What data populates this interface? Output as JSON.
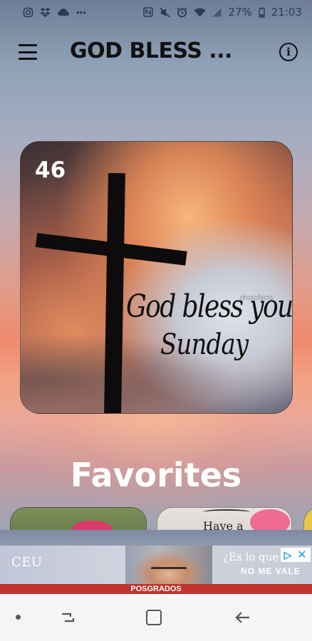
{
  "status_bar": {
    "left_icons": [
      "instagram-icon",
      "dropbox-icon",
      "cloud-icon",
      "more-dots-icon"
    ],
    "right_icons": [
      "nfc-icon",
      "mute-icon",
      "alarm-icon",
      "wifi-icon",
      "signal-icon",
      "battery-icon"
    ],
    "battery": "27%",
    "time": "21:03"
  },
  "app_bar": {
    "title": "GOD BLESS ...",
    "menu_icon": "hamburger-menu-icon",
    "info_icon": "info-icon",
    "info_glyph": "i"
  },
  "main_card": {
    "count": "46",
    "script_line_1": "God bless you",
    "script_line_2": "Sunday",
    "watermark": "photofacts"
  },
  "favorites": {
    "title": "Favorites",
    "item_2_word": "Have a"
  },
  "ad": {
    "brand": "CEU",
    "question": "¿Es lo que",
    "answer": "NO ME VALE",
    "footer": "POSGRADOS",
    "info_glyph": "▷",
    "close_glyph": "✕"
  },
  "nav_bar": {
    "items": [
      "dot-icon",
      "recent-apps-icon",
      "home-icon",
      "back-icon"
    ]
  },
  "colors": {
    "title": "#111111",
    "favorites_text": "#ffffff",
    "ad_footer": "#c0332e",
    "ad_accent": "#19a0d8"
  }
}
